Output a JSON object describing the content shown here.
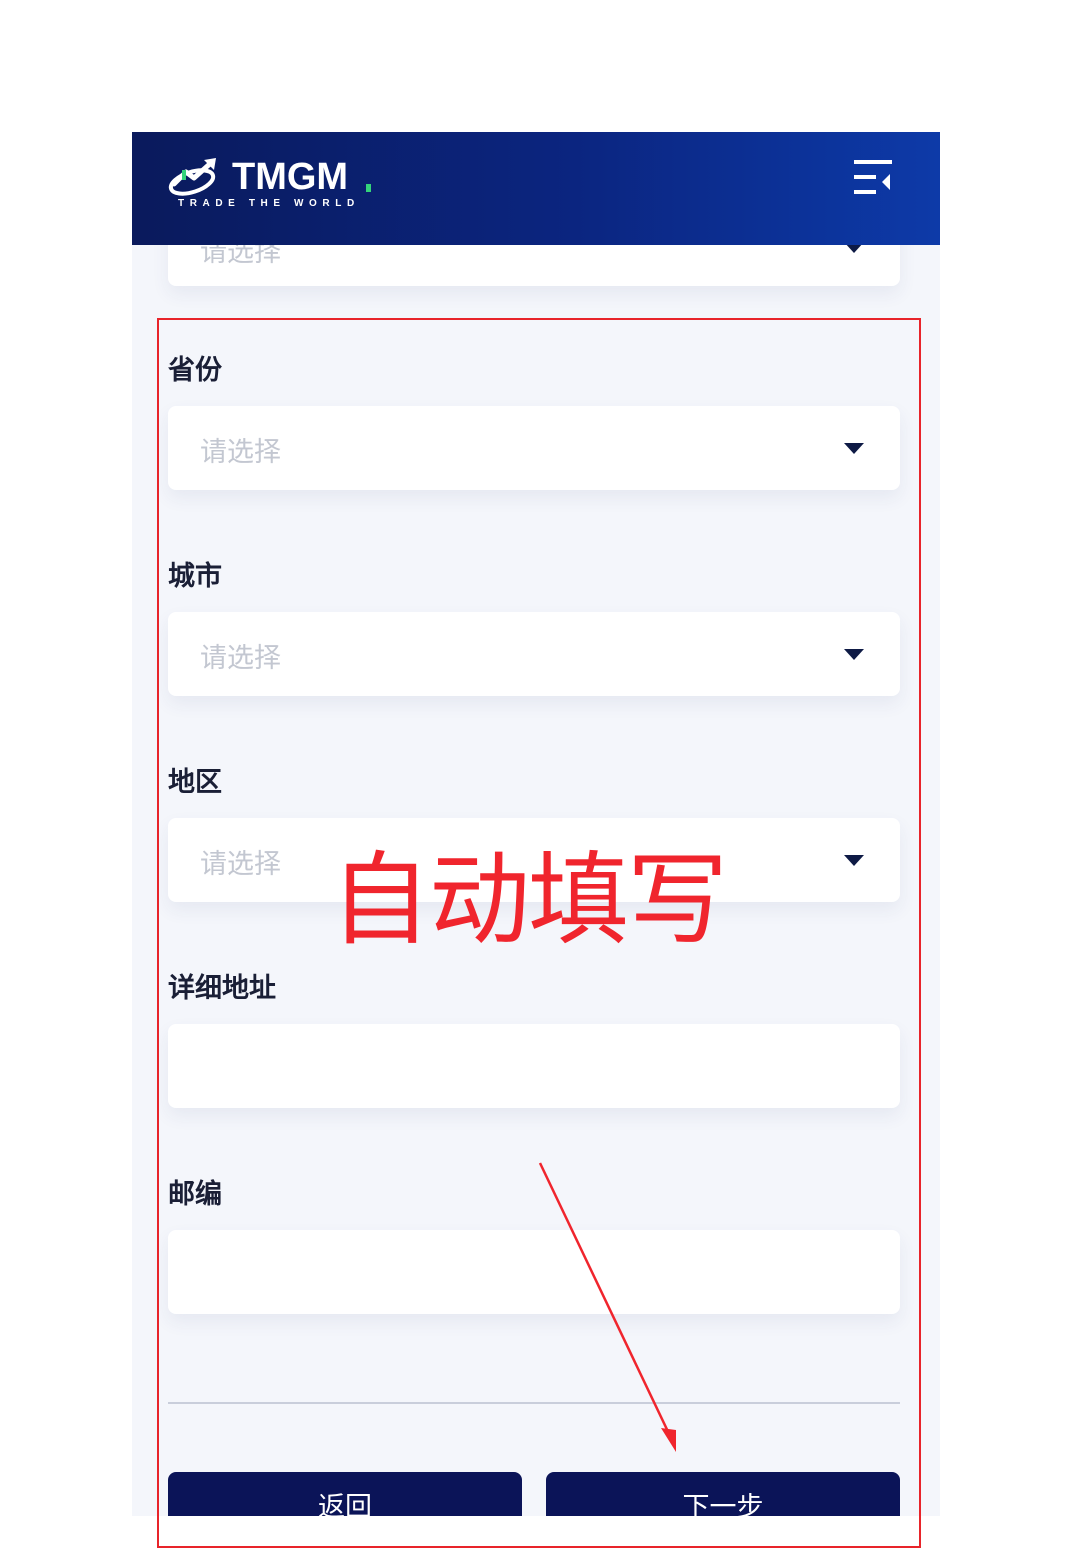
{
  "header": {
    "logo_text": "TMGM",
    "logo_tagline": "TRADE THE WORLD",
    "menu_icon": "menu-collapse-icon",
    "background": "#0b2580"
  },
  "top_field": {
    "placeholder": "请选择"
  },
  "fields": {
    "province": {
      "label": "省份",
      "placeholder": "请选择"
    },
    "city": {
      "label": "城市",
      "placeholder": "请选择"
    },
    "district": {
      "label": "地区",
      "placeholder": "请选择"
    },
    "address": {
      "label": "详细地址",
      "value": ""
    },
    "postcode": {
      "label": "邮编",
      "value": ""
    }
  },
  "actions": {
    "back_label": "返回",
    "next_label": "下一步"
  },
  "annotation": {
    "text": "自动填写",
    "color": "#f0252d"
  }
}
